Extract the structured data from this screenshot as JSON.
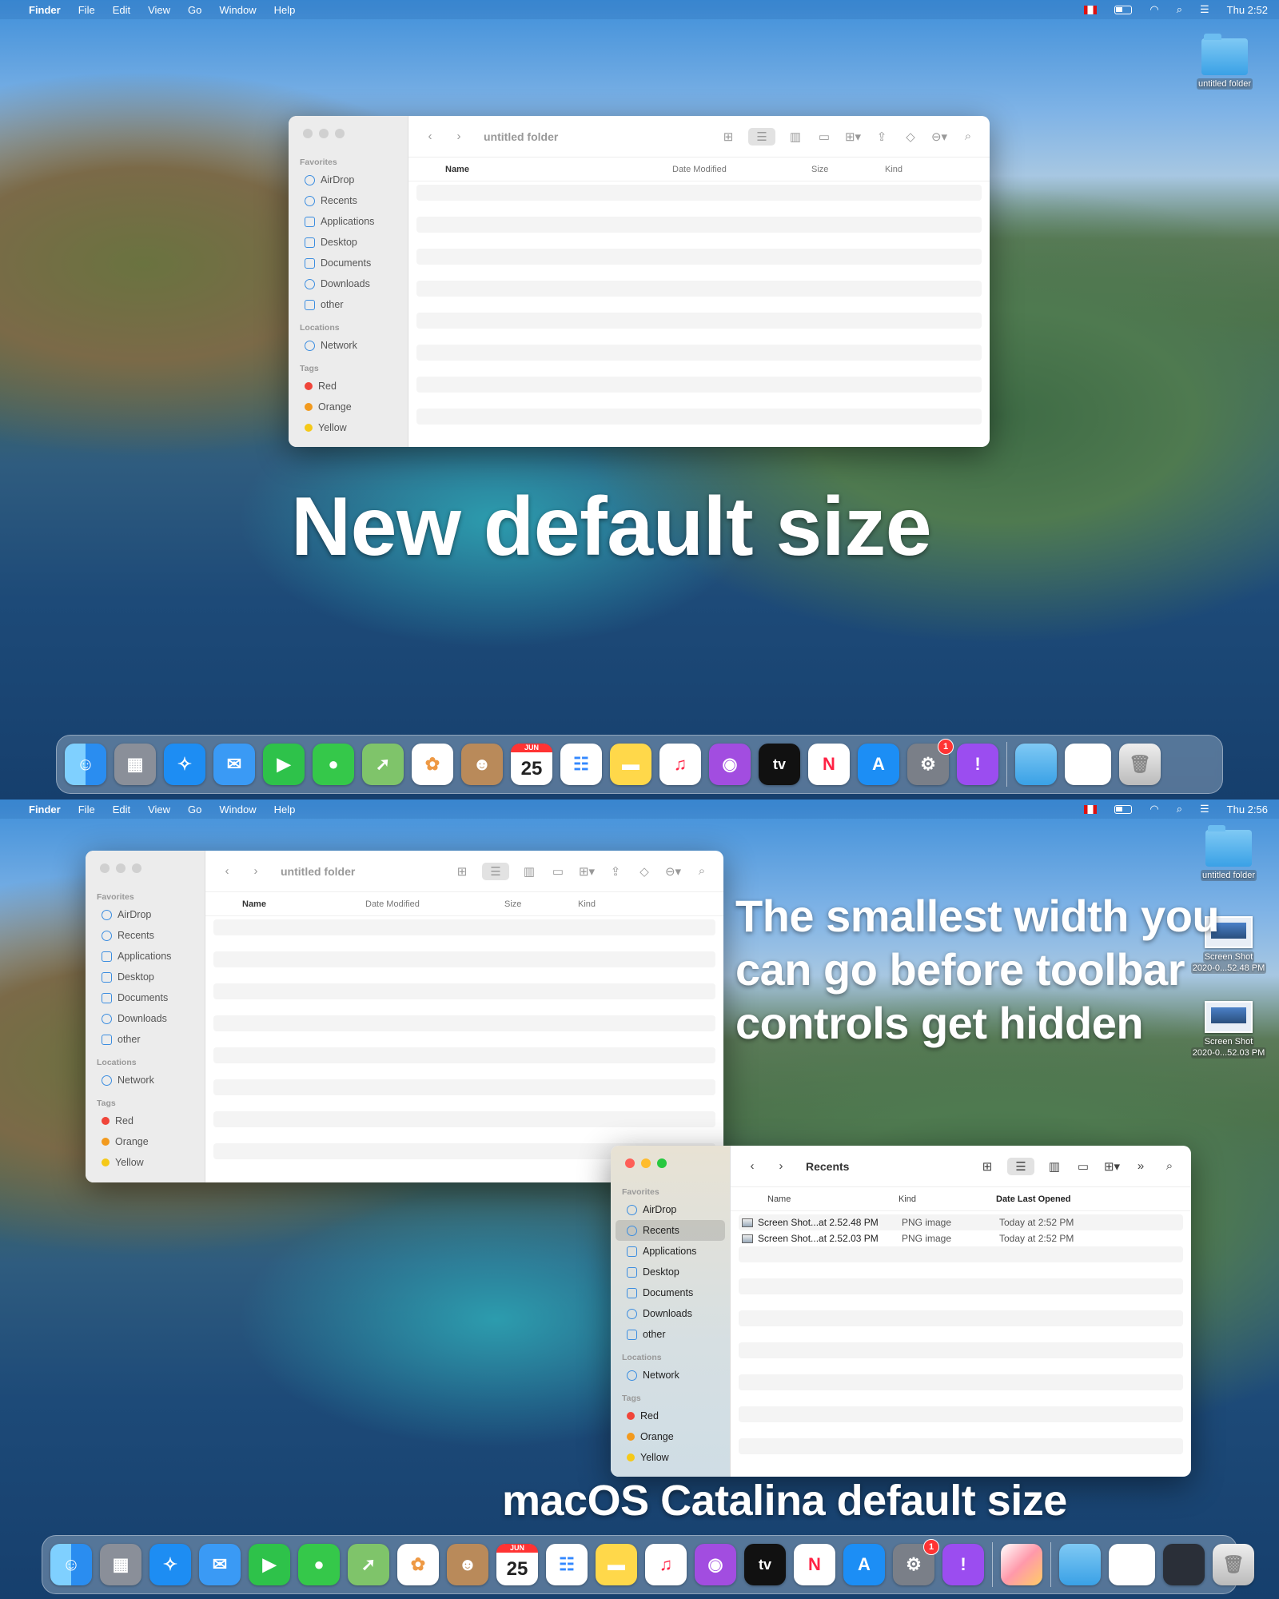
{
  "menubar": {
    "app_name": "Finder",
    "menus": [
      "File",
      "Edit",
      "View",
      "Go",
      "Window",
      "Help"
    ],
    "clock_top": "Thu 2:52",
    "clock_bottom": "Thu 2:56"
  },
  "desktop": {
    "folder_label": "untitled folder",
    "screenshots": [
      {
        "line1": "Screen Shot",
        "line2": "2020-0...52.48 PM"
      },
      {
        "line1": "Screen Shot",
        "line2": "2020-0...52.03 PM"
      }
    ]
  },
  "captions": {
    "top": "New default size",
    "bottom_right": "The smallest width you can go before toolbar controls get hidden",
    "bottom": "macOS Catalina default size"
  },
  "sidebar": {
    "favorites_header": "Favorites",
    "favorites": [
      "AirDrop",
      "Recents",
      "Applications",
      "Desktop",
      "Documents",
      "Downloads",
      "other"
    ],
    "locations_header": "Locations",
    "locations": [
      "Network"
    ],
    "tags_header": "Tags",
    "tags": [
      {
        "name": "Red",
        "color": "#f0453a"
      },
      {
        "name": "Orange",
        "color": "#f29a1e"
      },
      {
        "name": "Yellow",
        "color": "#f5c918"
      }
    ]
  },
  "finder_untitled": {
    "title": "untitled folder",
    "columns": [
      "Name",
      "Date Modified",
      "Size",
      "Kind"
    ]
  },
  "finder_recents": {
    "title": "Recents",
    "columns": [
      "Name",
      "Kind",
      "Date Last Opened"
    ],
    "rows": [
      {
        "name": "Screen Shot...at 2.52.48 PM",
        "kind": "PNG image",
        "date": "Today at 2:52 PM"
      },
      {
        "name": "Screen Shot...at 2.52.03 PM",
        "kind": "PNG image",
        "date": "Today at 2:52 PM"
      }
    ]
  },
  "dock": {
    "calendar_month": "JUN",
    "calendar_day": "25",
    "tv_label": "tv",
    "settings_badge": "1",
    "apps": [
      "finder-icon",
      "launchpad-icon",
      "safari-icon",
      "mail-icon",
      "facetime-icon",
      "messages-icon",
      "maps-icon",
      "photos-icon",
      "contacts-icon",
      "calendar-icon",
      "reminders-icon",
      "notes-icon",
      "music-icon",
      "podcasts-icon",
      "tv-icon",
      "news-icon",
      "appstore-icon",
      "settings-icon",
      "feedback-icon"
    ],
    "colors": {
      "finder": "#2a8df0",
      "launchpad": "#8a8f99",
      "safari": "#1d8df3",
      "mail": "#3a9af5",
      "facetime": "#2ec24a",
      "messages": "#35c84a",
      "maps": "#7fc46a",
      "photos": "#ffffff",
      "contacts": "#b98a5a",
      "reminders": "#ffffff",
      "notes": "#ffd84a",
      "music": "#ffffff",
      "podcasts": "#a24de0",
      "tv": "#111111",
      "news": "#ffffff",
      "appstore": "#1c8ef5",
      "settings": "#7a7f88",
      "feedback": "#9b4df0"
    }
  }
}
